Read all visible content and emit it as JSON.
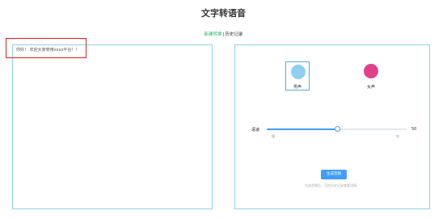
{
  "page": {
    "title": "文字转语音"
  },
  "tabs": {
    "new_label": "新建转换",
    "separator": "|",
    "history_label": "历史记录"
  },
  "editor": {
    "text": "你好！ 欢迎大家使用xxxx平台！！"
  },
  "voices": {
    "male_label": "男声",
    "female_label": "女声",
    "selected": "男声",
    "male_icon": "male-avatar-icon",
    "female_icon": "female-avatar-icon"
  },
  "speed": {
    "label": "语速",
    "value": "50",
    "min_label": "慢",
    "max_label": "快",
    "fraction": 0.5
  },
  "generate": {
    "button_label": "生成音频",
    "hint": "生成音频后，可在历史记录查看详情"
  },
  "colors": {
    "accent": "#409eff",
    "active_tab": "#27b469",
    "panel_border": "#8fd0e6",
    "highlight_border": "#e02020"
  }
}
